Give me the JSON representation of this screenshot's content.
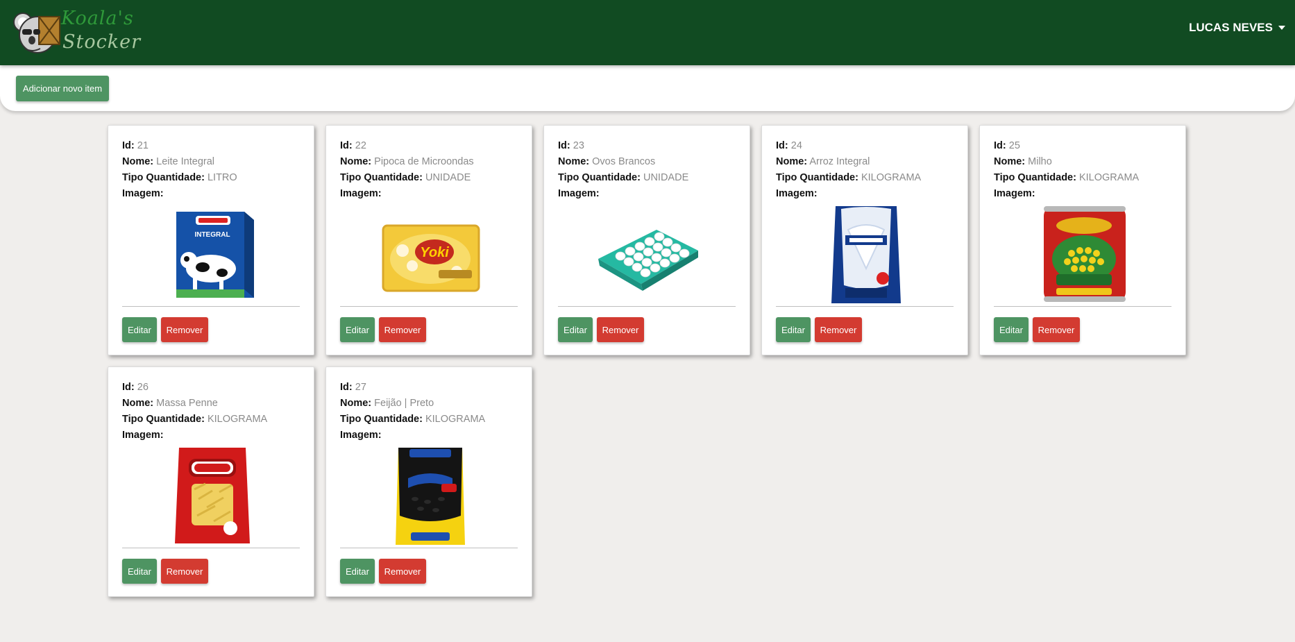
{
  "app": {
    "logo_line1": "Koala's",
    "logo_line2": "Stocker",
    "user_name": "LUCAS NEVES"
  },
  "toolbar": {
    "add_label": "Adicionar novo item"
  },
  "labels": {
    "id": "Id:",
    "nome": "Nome:",
    "tipo": "Tipo Quantidade:",
    "imagem": "Imagem:",
    "edit": "Editar",
    "remove": "Remover"
  },
  "items": [
    {
      "id": "21",
      "nome": "Leite Integral",
      "tipo": "LITRO",
      "image": "milk-carton"
    },
    {
      "id": "22",
      "nome": "Pipoca de Microondas",
      "tipo": "UNIDADE",
      "image": "popcorn-bag"
    },
    {
      "id": "23",
      "nome": "Ovos Brancos",
      "tipo": "UNIDADE",
      "image": "egg-tray"
    },
    {
      "id": "24",
      "nome": "Arroz Integral",
      "tipo": "KILOGRAMA",
      "image": "rice-bag"
    },
    {
      "id": "25",
      "nome": "Milho",
      "tipo": "KILOGRAMA",
      "image": "corn-can"
    },
    {
      "id": "26",
      "nome": "Massa Penne",
      "tipo": "KILOGRAMA",
      "image": "pasta-bag"
    },
    {
      "id": "27",
      "nome": "Feijão | Preto",
      "tipo": "KILOGRAMA",
      "image": "beans-bag"
    }
  ],
  "colors": {
    "header_bg": "#114b22",
    "primary_green": "#4e9462",
    "danger_red": "#d33b31",
    "page_bg": "#f0eeec"
  }
}
